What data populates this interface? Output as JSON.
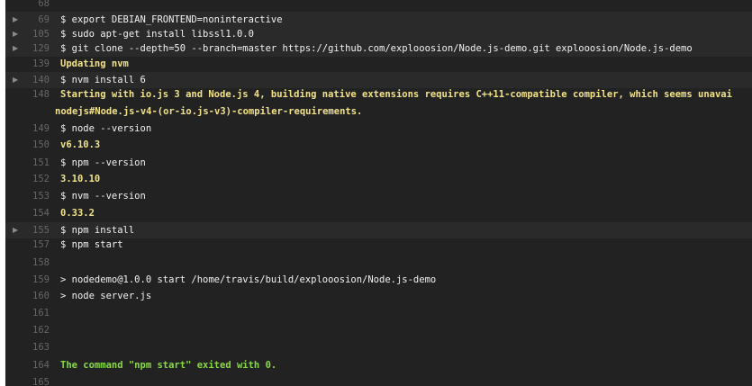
{
  "log": {
    "colors": {
      "background": "#222222",
      "fold_background": "#2a2a2a",
      "line_number": "#666666",
      "text": "#f1f1f1",
      "yellow": "#f2e28a",
      "green": "#88d848"
    },
    "lines": [
      {
        "num": "68",
        "text": "",
        "fold": false
      },
      {
        "num": "69",
        "text": "$ export DEBIAN_FRONTEND=noninteractive",
        "fold": true
      },
      {
        "num": "105",
        "text": "$ sudo apt-get install libssl1.0.0",
        "fold": true
      },
      {
        "num": "129",
        "text": "$ git clone --depth=50 --branch=master https://github.com/explooosion/Node.js-demo.git explooosion/Node.js-demo",
        "fold": true
      },
      {
        "num": "139",
        "text": "Updating nvm",
        "fold": false
      },
      {
        "num": "140",
        "text": "$ nvm install 6",
        "fold": true
      },
      {
        "num": "148",
        "text": "Starting with io.js 3 and Node.js 4, building native extensions requires C++11-compatible compiler, which seems unavai",
        "fold": false
      },
      {
        "num": "",
        "text": "nodejs#Node.js-v4-(or-io.js-v3)-compiler-requirements.",
        "fold": false
      },
      {
        "num": "149",
        "text": "$ node --version",
        "fold": false
      },
      {
        "num": "150",
        "text": "v6.10.3",
        "fold": false
      },
      {
        "num": "151",
        "text": "$ npm --version",
        "fold": false
      },
      {
        "num": "152",
        "text": "3.10.10",
        "fold": false
      },
      {
        "num": "153",
        "text": "$ nvm --version",
        "fold": false
      },
      {
        "num": "154",
        "text": "0.33.2",
        "fold": false
      },
      {
        "num": "155",
        "text": "$ npm install",
        "fold": true
      },
      {
        "num": "157",
        "text": "$ npm start",
        "fold": false
      },
      {
        "num": "158",
        "text": "",
        "fold": false
      },
      {
        "num": "159",
        "text": "> nodedemo@1.0.0 start /home/travis/build/explooosion/Node.js-demo",
        "fold": false
      },
      {
        "num": "160",
        "text": "> node server.js",
        "fold": false
      },
      {
        "num": "161",
        "text": "",
        "fold": false
      },
      {
        "num": "162",
        "text": "",
        "fold": false
      },
      {
        "num": "163",
        "text": "",
        "fold": false
      },
      {
        "num": "164",
        "text": "The command \"npm start\" exited with 0.",
        "fold": false
      },
      {
        "num": "165",
        "text": "",
        "fold": false
      }
    ],
    "fold_arrow": "▶"
  }
}
